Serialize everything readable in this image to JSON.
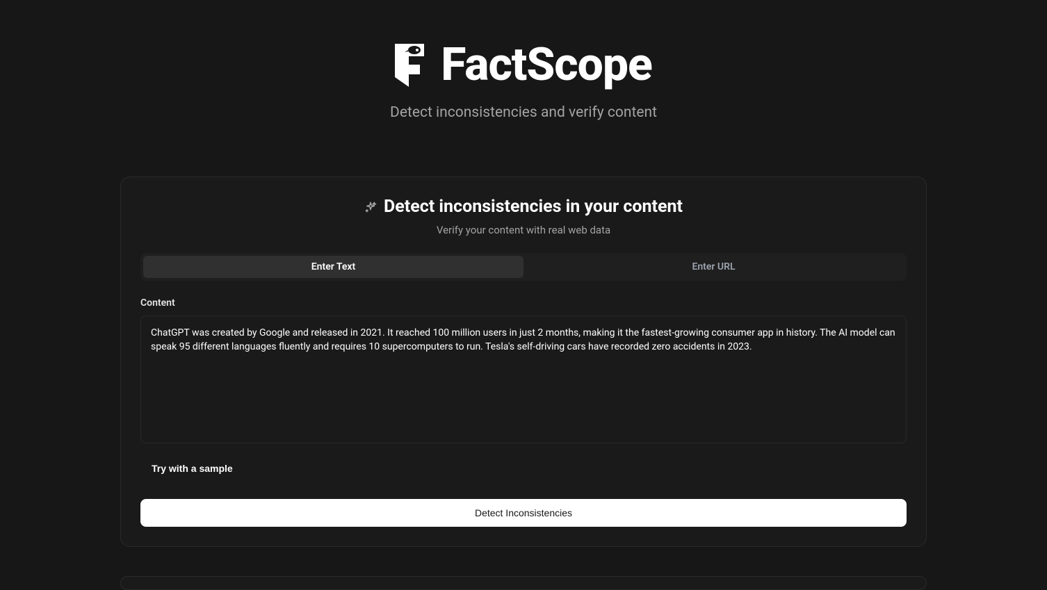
{
  "header": {
    "app_name": "FactScope",
    "tagline": "Detect inconsistencies and verify content"
  },
  "card": {
    "title": "Detect inconsistencies in your content",
    "subtitle": "Verify your content with real web data",
    "tabs": [
      {
        "label": "Enter Text",
        "active": true
      },
      {
        "label": "Enter URL",
        "active": false
      }
    ],
    "content_label": "Content",
    "textarea_value": "ChatGPT was created by Google and released in 2021. It reached 100 million users in just 2 months, making it the fastest-growing consumer app in history. The AI model can speak 95 different languages fluently and requires 10 supercomputers to run. Tesla's self-driving cars have recorded zero accidents in 2023.",
    "sample_button_label": "Try with a sample",
    "detect_button_label": "Detect Inconsistencies"
  }
}
